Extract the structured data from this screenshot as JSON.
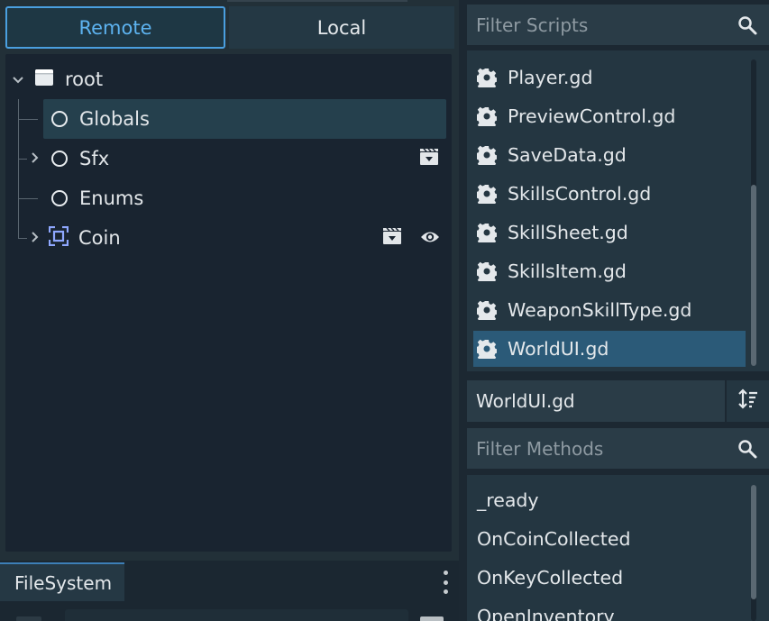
{
  "scene_tabs": {
    "remote_label": "Remote",
    "local_label": "Local"
  },
  "scene_tree": {
    "root_label": "root",
    "nodes": [
      {
        "label": "Globals",
        "icon": "node-circle-icon",
        "selected": true
      },
      {
        "label": "Sfx",
        "icon": "node-circle-icon",
        "expandable": true,
        "badges": [
          "instance-scene-icon"
        ]
      },
      {
        "label": "Enums",
        "icon": "node-circle-icon"
      },
      {
        "label": "Coin",
        "icon": "control-node-icon",
        "expandable": true,
        "badges": [
          "instance-scene-icon",
          "visibility-eye-icon"
        ]
      }
    ]
  },
  "filesystem": {
    "tab_label": "FileSystem"
  },
  "scripts": {
    "filter_placeholder": "Filter Scripts",
    "items": [
      "Player.gd",
      "PreviewControl.gd",
      "SaveData.gd",
      "SkillsControl.gd",
      "SkillSheet.gd",
      "SkillsItem.gd",
      "WeaponSkillType.gd",
      "WorldUI.gd"
    ],
    "selected": "WorldUI.gd",
    "current_script": "WorldUI.gd"
  },
  "methods": {
    "filter_placeholder": "Filter Methods",
    "items": [
      "_ready",
      "OnCoinCollected",
      "OnKeyCollected",
      "OpenInventory"
    ]
  },
  "colors": {
    "accent": "#4a9fe0",
    "selected_row": "#2b5a78",
    "control_icon": "#8fa8ff"
  }
}
